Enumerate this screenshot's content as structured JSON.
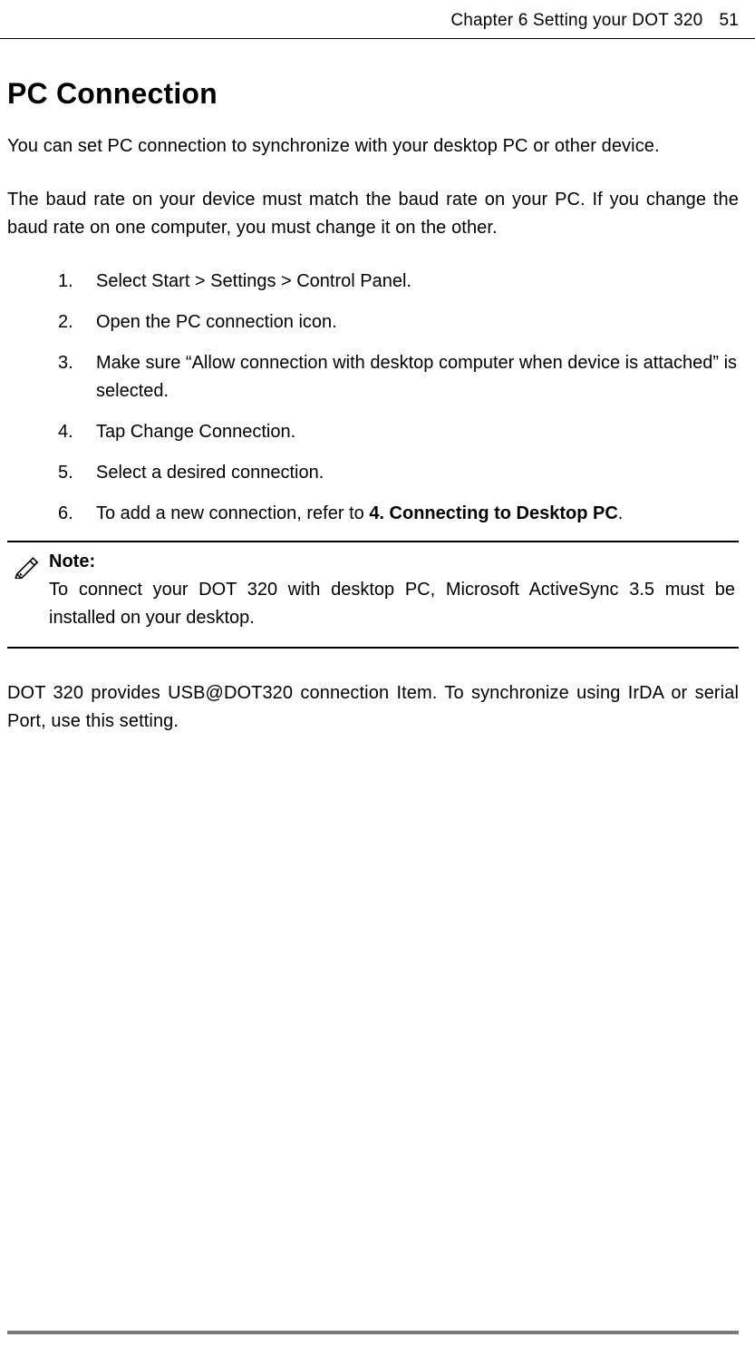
{
  "header": {
    "chapter": "Chapter 6    Setting your DOT 320",
    "page_number": "51"
  },
  "main": {
    "title": "PC Connection",
    "intro": "You can set PC connection to synchronize with your desktop PC or other device.",
    "baud_paragraph": "The baud rate on your device must match the baud rate on your PC. If you change the baud rate on one computer, you must change it on the other.",
    "steps": [
      "Select Start > Settings > Control Panel.",
      "Open the PC connection icon.",
      "Make sure “Allow connection with desktop computer when device is attached” is selected.",
      "Tap Change Connection.",
      "Select a desired connection."
    ],
    "step6_prefix": "To add a new connection, refer to ",
    "step6_bold": "4. Connecting to Desktop PC",
    "step6_suffix": ".",
    "note": {
      "label": "Note:",
      "body": "To connect your DOT 320 with desktop PC, Microsoft ActiveSync 3.5 must be installed on your desktop."
    },
    "closing": "DOT 320 provides USB@DOT320 connection Item. To synchronize using IrDA or serial Port, use this setting."
  }
}
